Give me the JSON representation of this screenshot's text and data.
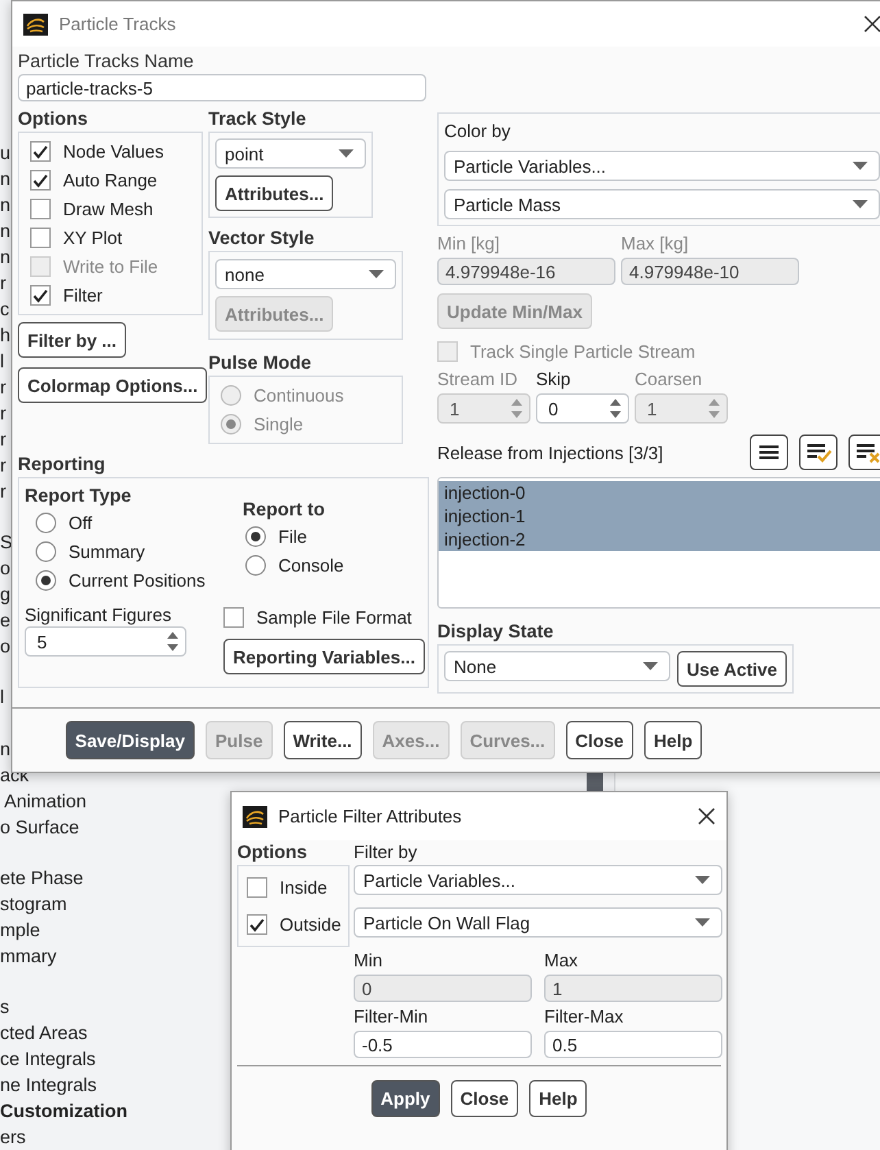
{
  "background_tree": {
    "items": [
      {
        "kind": "item",
        "text": "u"
      },
      {
        "kind": "item",
        "text": "n"
      },
      {
        "kind": "item",
        "text": "n"
      },
      {
        "kind": "item",
        "text": "n"
      },
      {
        "kind": "item",
        "text": "n"
      },
      {
        "kind": "item",
        "text": "r"
      },
      {
        "kind": "item",
        "text": "c"
      },
      {
        "kind": "item",
        "text": "h"
      },
      {
        "kind": "item",
        "text": "l"
      },
      {
        "kind": "item",
        "text": "r"
      },
      {
        "kind": "item",
        "text": "r"
      },
      {
        "kind": "item",
        "text": "r"
      },
      {
        "kind": "item",
        "text": "r"
      },
      {
        "kind": "item",
        "text": "r"
      },
      {
        "kind": "blank"
      },
      {
        "kind": "item",
        "text": "S"
      },
      {
        "kind": "item",
        "text": "o"
      },
      {
        "kind": "item",
        "text": "g"
      },
      {
        "kind": "item",
        "text": "e"
      },
      {
        "kind": "item",
        "text": "o"
      },
      {
        "kind": "blank"
      },
      {
        "kind": "item",
        "text": "l"
      },
      {
        "kind": "blank"
      },
      {
        "kind": "item",
        "text": "n"
      },
      {
        "kind": "item",
        "text": "ack"
      },
      {
        "kind": "item",
        "text": " Animation"
      },
      {
        "kind": "item",
        "text": "o Surface"
      },
      {
        "kind": "blank"
      },
      {
        "kind": "item",
        "text": "ete Phase"
      },
      {
        "kind": "item",
        "text": "stogram"
      },
      {
        "kind": "item",
        "text": "mple"
      },
      {
        "kind": "item",
        "text": "mmary"
      },
      {
        "kind": "blank"
      },
      {
        "kind": "item",
        "text": "s"
      },
      {
        "kind": "item",
        "text": "cted Areas"
      },
      {
        "kind": "item",
        "text": "ce Integrals"
      },
      {
        "kind": "item",
        "text": "ne Integrals"
      },
      {
        "kind": "heading",
        "text": "Customization"
      },
      {
        "kind": "item",
        "text": "ers"
      }
    ]
  },
  "main_dialog": {
    "title": "Particle Tracks",
    "name": {
      "label": "Particle Tracks Name",
      "value": "particle-tracks-5"
    },
    "options": {
      "label": "Options",
      "items": [
        {
          "label": "Node Values",
          "checked": true,
          "disabled": false
        },
        {
          "label": "Auto Range",
          "checked": true,
          "disabled": false
        },
        {
          "label": "Draw Mesh",
          "checked": false,
          "disabled": false
        },
        {
          "label": "XY Plot",
          "checked": false,
          "disabled": false
        },
        {
          "label": "Write to File",
          "checked": false,
          "disabled": true
        },
        {
          "label": "Filter",
          "checked": true,
          "disabled": false
        }
      ]
    },
    "filter_button": {
      "label": "Filter by ...",
      "disabled": false
    },
    "colormap_button": {
      "label": "Colormap Options...",
      "disabled": false
    },
    "track_style": {
      "label": "Track Style",
      "value": "point",
      "button": {
        "label": "Attributes...",
        "disabled": false
      }
    },
    "vector_style": {
      "label": "Vector Style",
      "value": "none",
      "button": {
        "label": "Attributes...",
        "disabled": true
      }
    },
    "pulse_mode": {
      "label": "Pulse Mode",
      "items": [
        {
          "label": "Continuous",
          "selected": false,
          "disabled": true
        },
        {
          "label": "Single",
          "selected": true,
          "disabled": true
        }
      ]
    },
    "color_by": {
      "label": "Color by",
      "selects": [
        "Particle Variables...",
        "Particle Mass"
      ]
    },
    "range": [
      {
        "label": "Min [kg]",
        "value": "4.979948e-16",
        "disabled": true
      },
      {
        "label": "Max [kg]",
        "value": "4.979948e-10",
        "disabled": true
      }
    ],
    "update_button": {
      "label": "Update Min/Max",
      "disabled": true
    },
    "track_single": {
      "label": "Track Single Particle Stream",
      "checked": false,
      "disabled": true
    },
    "spinners": [
      {
        "label": "Stream ID",
        "value": "1",
        "disabled": true
      },
      {
        "label": "Skip",
        "value": "0",
        "disabled": false
      },
      {
        "label": "Coarsen",
        "value": "1",
        "disabled": true
      }
    ],
    "injections": {
      "label": "Release from Injections",
      "count": "[3/3]",
      "items": [
        {
          "label": "injection-0",
          "selected": true
        },
        {
          "label": "injection-1",
          "selected": true
        },
        {
          "label": "injection-2",
          "selected": true
        }
      ]
    },
    "display_state": {
      "label": "Display State",
      "value": "None",
      "button": {
        "label": "Use Active",
        "disabled": false
      }
    },
    "reporting": {
      "label": "Reporting",
      "report_type": {
        "label": "Report Type",
        "items": [
          {
            "label": "Off",
            "selected": false
          },
          {
            "label": "Summary",
            "selected": false
          },
          {
            "label": "Current Positions",
            "selected": true
          }
        ]
      },
      "report_to": {
        "label": "Report to",
        "items": [
          {
            "label": "File",
            "selected": true
          },
          {
            "label": "Console",
            "selected": false
          }
        ]
      },
      "significant_figures": {
        "label": "Significant Figures",
        "value": "5"
      },
      "sample_file_format": {
        "label": "Sample File Format",
        "checked": false
      },
      "variables_button": {
        "label": "Reporting Variables...",
        "disabled": false
      }
    },
    "buttons": [
      {
        "label": "Save/Display",
        "kind": "primary",
        "disabled": false
      },
      {
        "label": "Pulse",
        "kind": "normal",
        "disabled": true
      },
      {
        "label": "Write...",
        "kind": "normal",
        "disabled": false
      },
      {
        "label": "Axes...",
        "kind": "normal",
        "disabled": true
      },
      {
        "label": "Curves...",
        "kind": "normal",
        "disabled": true
      },
      {
        "label": "Close",
        "kind": "normal",
        "disabled": false
      },
      {
        "label": "Help",
        "kind": "normal",
        "disabled": false
      }
    ]
  },
  "filter_dialog": {
    "title": "Particle Filter Attributes",
    "options": {
      "label": "Options",
      "items": [
        {
          "label": "Inside",
          "checked": false
        },
        {
          "label": "Outside",
          "checked": true
        }
      ]
    },
    "filter_by": {
      "label": "Filter by",
      "selects": [
        "Particle Variables...",
        "Particle On Wall Flag"
      ]
    },
    "fields": [
      {
        "label": "Min",
        "value": "0",
        "disabled": true
      },
      {
        "label": "Max",
        "value": "1",
        "disabled": true
      },
      {
        "label": "Filter-Min",
        "value": "-0.5",
        "disabled": false
      },
      {
        "label": "Filter-Max",
        "value": "0.5",
        "disabled": false
      }
    ],
    "buttons": [
      {
        "label": "Apply",
        "kind": "primary",
        "disabled": false
      },
      {
        "label": "Close",
        "kind": "normal",
        "disabled": false
      },
      {
        "label": "Help",
        "kind": "normal",
        "disabled": false
      }
    ]
  }
}
